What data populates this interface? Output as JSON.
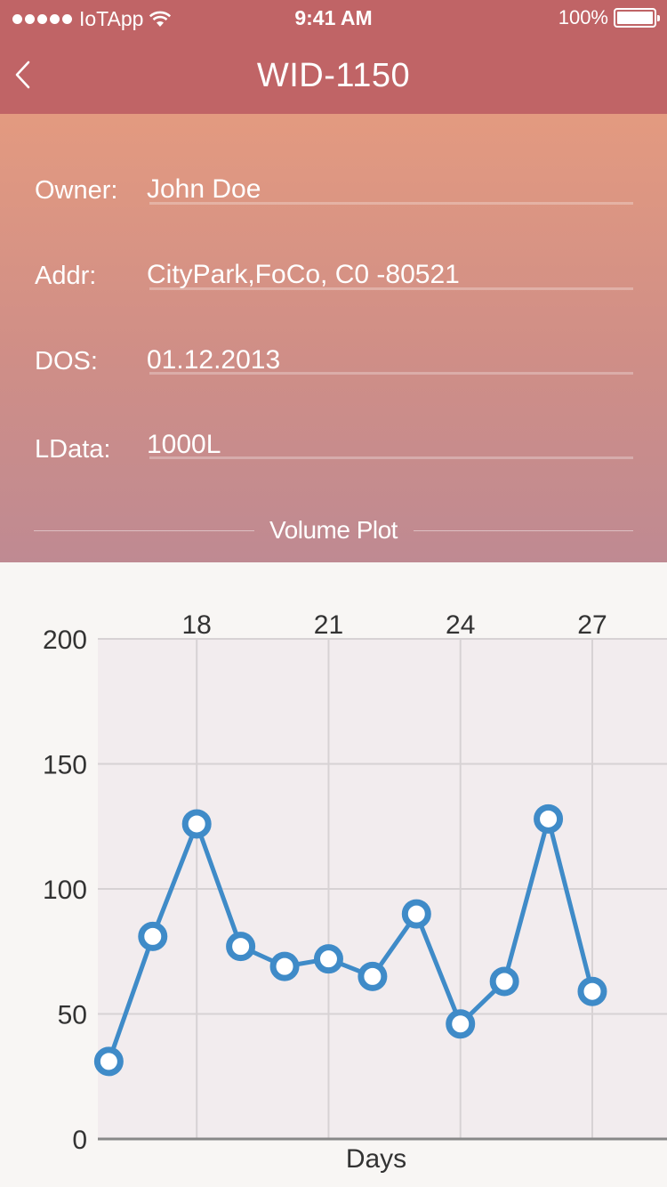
{
  "status_bar": {
    "carrier": "IoTApp",
    "time": "9:41 AM",
    "battery": "100%"
  },
  "nav": {
    "title": "WID-1150",
    "back_icon": "chevron-left-icon"
  },
  "fields": [
    {
      "label": "Owner:",
      "value": "John Doe"
    },
    {
      "label": "Addr:",
      "value": "CityPark,FoCo, C0 -80521"
    },
    {
      "label": "DOS:",
      "value": "01.12.2013"
    },
    {
      "label": "LData:",
      "value": "1000L"
    }
  ],
  "section_label": "Volume Plot",
  "colors": {
    "header": "#c06466",
    "line": "#3f8bc8",
    "plot_bg": "#f2ecee"
  },
  "chart_data": {
    "type": "line",
    "title": "",
    "xlabel": "Days",
    "ylabel": "",
    "ylim": [
      0,
      200
    ],
    "xlim": [
      15.75,
      28.7
    ],
    "yticks": [
      "0",
      "50",
      "100",
      "150",
      "200"
    ],
    "xticks_top": [
      "18",
      "21",
      "24",
      "27"
    ],
    "grid": true,
    "series": [
      {
        "x": [
          16,
          17,
          18,
          19,
          20,
          21,
          22,
          23,
          24,
          25,
          26,
          27
        ],
        "y": [
          31,
          81,
          126,
          77,
          69,
          72,
          65,
          90,
          46,
          63,
          128,
          59
        ]
      }
    ]
  }
}
